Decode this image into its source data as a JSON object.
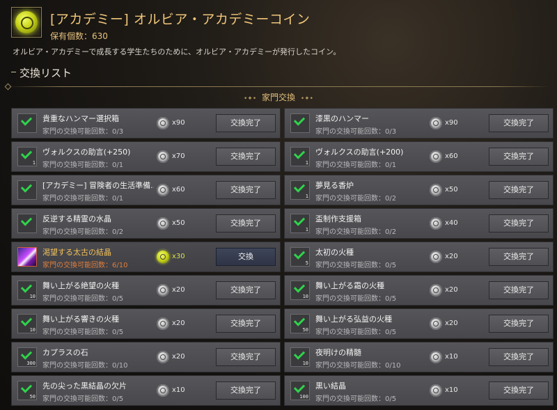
{
  "header": {
    "title": "[アカデミー] オルビア・アカデミーコイン",
    "owned": "保有個数：630",
    "description": "オルビア・アカデミーで成長する学生たちのために、オルビア・アカデミーが発行したコイン。",
    "list_title": "交換リスト"
  },
  "section": {
    "label": "家門交換",
    "left_ornament": "•✦•",
    "right_ornament": "•✦•"
  },
  "colors": {
    "accent": "#f0c77a",
    "check": "#2fd34a",
    "limit_active": "#e07f3e"
  },
  "items": [
    {
      "name": "貴重なハンマー選択箱",
      "limit": "家門の交換可能回数：0/3",
      "cost": "x90",
      "button": "交換完了",
      "qty": "",
      "checked": true,
      "active": false
    },
    {
      "name": "漆黒のハンマー",
      "limit": "家門の交換可能回数：0/3",
      "cost": "x90",
      "button": "交換完了",
      "qty": "",
      "checked": true,
      "active": false
    },
    {
      "name": "ヴォルクスの助言(+250)",
      "limit": "家門の交換可能回数：0/1",
      "cost": "x70",
      "button": "交換完了",
      "qty": "1",
      "checked": true,
      "active": false
    },
    {
      "name": "ヴォルクスの助言(+200)",
      "limit": "家門の交換可能回数：0/1",
      "cost": "x60",
      "button": "交換完了",
      "qty": "1",
      "checked": true,
      "active": false
    },
    {
      "name": "[アカデミー] 冒険者の生活準備...",
      "limit": "家門の交換可能回数：0/1",
      "cost": "x60",
      "button": "交換完了",
      "qty": "",
      "checked": true,
      "active": false
    },
    {
      "name": "夢見る香炉",
      "limit": "家門の交換可能回数：0/2",
      "cost": "x50",
      "button": "交換完了",
      "qty": "1",
      "checked": true,
      "active": false
    },
    {
      "name": "反逆する精霊の水晶",
      "limit": "家門の交換可能回数：0/2",
      "cost": "x50",
      "button": "交換完了",
      "qty": "",
      "checked": true,
      "active": false
    },
    {
      "name": "盃制作支援箱",
      "limit": "家門の交換可能回数：0/2",
      "cost": "x40",
      "button": "交換完了",
      "qty": "1",
      "checked": true,
      "active": false
    },
    {
      "name": "渇望する太古の結晶",
      "limit": "家門の交換可能回数：6/10",
      "cost": "x30",
      "button": "交換",
      "qty": "",
      "checked": false,
      "active": true
    },
    {
      "name": "太初の火種",
      "limit": "家門の交換可能回数：0/5",
      "cost": "x20",
      "button": "交換完了",
      "qty": "5",
      "checked": true,
      "active": false
    },
    {
      "name": "舞い上がる絶望の火種",
      "limit": "家門の交換可能回数：0/5",
      "cost": "x20",
      "button": "交換完了",
      "qty": "10",
      "checked": true,
      "active": false
    },
    {
      "name": "舞い上がる霜の火種",
      "limit": "家門の交換可能回数：0/5",
      "cost": "x20",
      "button": "交換完了",
      "qty": "10",
      "checked": true,
      "active": false
    },
    {
      "name": "舞い上がる響きの火種",
      "limit": "家門の交換可能回数：0/5",
      "cost": "x20",
      "button": "交換完了",
      "qty": "10",
      "checked": true,
      "active": false
    },
    {
      "name": "舞い上がる弘益の火種",
      "limit": "家門の交換可能回数：0/5",
      "cost": "x20",
      "button": "交換完了",
      "qty": "50",
      "checked": true,
      "active": false
    },
    {
      "name": "カプラスの石",
      "limit": "家門の交換可能回数：0/10",
      "cost": "x20",
      "button": "交換完了",
      "qty": "300",
      "checked": true,
      "active": false
    },
    {
      "name": "夜明けの精髄",
      "limit": "家門の交換可能回数：0/10",
      "cost": "x10",
      "button": "交換完了",
      "qty": "10",
      "checked": true,
      "active": false
    },
    {
      "name": "先の尖った黒結晶の欠片",
      "limit": "家門の交換可能回数：0/5",
      "cost": "x10",
      "button": "交換完了",
      "qty": "50",
      "checked": true,
      "active": false
    },
    {
      "name": "黒い結晶",
      "limit": "家門の交換可能回数：0/5",
      "cost": "x10",
      "button": "交換完了",
      "qty": "100",
      "checked": true,
      "active": false
    }
  ]
}
